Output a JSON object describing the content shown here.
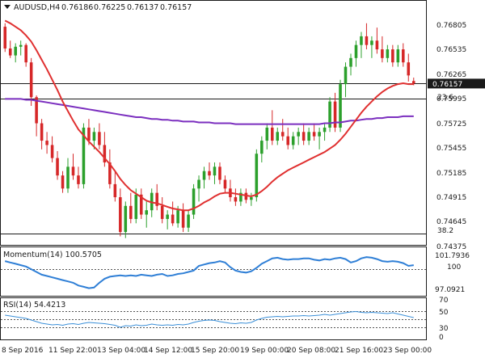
{
  "header": {
    "symbol": "AUDUSD,H4",
    "open": "0.76186",
    "high": "0.76225",
    "low": "0.76137",
    "close": "0.76157"
  },
  "colors": {
    "bull": "#2ca02c",
    "bear": "#d62728",
    "fast_ma": "#e03030",
    "slow_ma": "#7b2fbf",
    "momentum": "#2f7fd6",
    "rsi": "#3a8fd8",
    "level_line": "#1a1a1a",
    "dotted": "#555555",
    "price_box": "#1a1a1a"
  },
  "price_axis": {
    "ticks": [
      "0.76805",
      "0.76535",
      "0.76265",
      "0.75995",
      "0.75725",
      "0.75455",
      "0.75185",
      "0.74915",
      "0.74645",
      "0.74375"
    ],
    "current_price": "0.76157"
  },
  "fib_labels": {
    "upper": "23.6",
    "lower": "38.2"
  },
  "time_axis": {
    "ticks": [
      "8 Sep 2016",
      "11 Sep 22:00",
      "13 Sep 04:00",
      "14 Sep 12:00",
      "15 Sep 20:00",
      "19 Sep 00:00",
      "20 Sep 08:00",
      "21 Sep 16:00",
      "23 Sep 00:00"
    ]
  },
  "momentum_panel": {
    "title": "Momentum(14) 100.5705",
    "ticks": [
      "101.7936",
      "100",
      "97.0921"
    ]
  },
  "rsi_panel": {
    "title": "RSI(14) 54.4213",
    "ticks": [
      "70",
      "50",
      "30",
      "0"
    ]
  },
  "chart_data": {
    "type": "candlestick",
    "title": "AUDUSD,H4",
    "ylim": [
      0.7433,
      0.7695
    ],
    "levels": [
      {
        "label": "23.6",
        "value": 0.7598
      },
      {
        "label": "38.2",
        "value": 0.7443
      },
      {
        "label": "current",
        "value": 0.76157
      }
    ],
    "candles": [
      [
        0.7681,
        0.7685,
        0.7652,
        0.7656
      ],
      [
        0.7656,
        0.7665,
        0.7645,
        0.7648
      ],
      [
        0.7648,
        0.7662,
        0.764,
        0.7658
      ],
      [
        0.7658,
        0.7665,
        0.7648,
        0.766
      ],
      [
        0.766,
        0.7662,
        0.7635,
        0.764
      ],
      [
        0.764,
        0.7645,
        0.759,
        0.76
      ],
      [
        0.76,
        0.7602,
        0.7555,
        0.757
      ],
      [
        0.757,
        0.7575,
        0.754,
        0.755
      ],
      [
        0.755,
        0.756,
        0.7535,
        0.7545
      ],
      [
        0.7545,
        0.7555,
        0.7525,
        0.753
      ],
      [
        0.753,
        0.7538,
        0.7505,
        0.751
      ],
      [
        0.751,
        0.7515,
        0.749,
        0.7495
      ],
      [
        0.7495,
        0.753,
        0.749,
        0.752
      ],
      [
        0.752,
        0.7535,
        0.7505,
        0.751
      ],
      [
        0.751,
        0.752,
        0.7495,
        0.75
      ],
      [
        0.75,
        0.757,
        0.7495,
        0.7565
      ],
      [
        0.7565,
        0.7575,
        0.7545,
        0.755
      ],
      [
        0.755,
        0.7565,
        0.754,
        0.756
      ],
      [
        0.756,
        0.757,
        0.754,
        0.7545
      ],
      [
        0.7545,
        0.756,
        0.752,
        0.7525
      ],
      [
        0.7525,
        0.754,
        0.7495,
        0.75
      ],
      [
        0.75,
        0.7515,
        0.748,
        0.7485
      ],
      [
        0.7485,
        0.7495,
        0.744,
        0.7445
      ],
      [
        0.7445,
        0.748,
        0.7438,
        0.7475
      ],
      [
        0.7475,
        0.749,
        0.7455,
        0.746
      ],
      [
        0.746,
        0.7495,
        0.7455,
        0.7488
      ],
      [
        0.7488,
        0.7495,
        0.746,
        0.7465
      ],
      [
        0.7465,
        0.748,
        0.745,
        0.747
      ],
      [
        0.747,
        0.7495,
        0.7462,
        0.749
      ],
      [
        0.749,
        0.75,
        0.747,
        0.7475
      ],
      [
        0.7475,
        0.7485,
        0.7455,
        0.746
      ],
      [
        0.746,
        0.747,
        0.7448,
        0.7465
      ],
      [
        0.7465,
        0.748,
        0.7452,
        0.7455
      ],
      [
        0.7455,
        0.7475,
        0.745,
        0.747
      ],
      [
        0.747,
        0.7478,
        0.7445,
        0.745
      ],
      [
        0.745,
        0.747,
        0.7445,
        0.7465
      ],
      [
        0.7465,
        0.75,
        0.746,
        0.7495
      ],
      [
        0.7495,
        0.751,
        0.748,
        0.7505
      ],
      [
        0.7505,
        0.752,
        0.7495,
        0.7515
      ],
      [
        0.7515,
        0.7525,
        0.7505,
        0.751
      ],
      [
        0.751,
        0.7525,
        0.75,
        0.752
      ],
      [
        0.752,
        0.7525,
        0.75,
        0.7505
      ],
      [
        0.7505,
        0.751,
        0.749,
        0.7495
      ],
      [
        0.7495,
        0.7505,
        0.748,
        0.7485
      ],
      [
        0.7485,
        0.7495,
        0.7475,
        0.748
      ],
      [
        0.748,
        0.7495,
        0.7475,
        0.749
      ],
      [
        0.749,
        0.7495,
        0.7478,
        0.7482
      ],
      [
        0.7482,
        0.749,
        0.7475,
        0.7485
      ],
      [
        0.7485,
        0.754,
        0.748,
        0.7535
      ],
      [
        0.7535,
        0.7555,
        0.7525,
        0.755
      ],
      [
        0.755,
        0.757,
        0.754,
        0.7565
      ],
      [
        0.7565,
        0.7585,
        0.7545,
        0.755
      ],
      [
        0.755,
        0.7565,
        0.7545,
        0.756
      ],
      [
        0.756,
        0.7575,
        0.755,
        0.7555
      ],
      [
        0.7555,
        0.7565,
        0.754,
        0.7545
      ],
      [
        0.7545,
        0.756,
        0.754,
        0.7555
      ],
      [
        0.7555,
        0.7565,
        0.7545,
        0.756
      ],
      [
        0.756,
        0.757,
        0.7545,
        0.755
      ],
      [
        0.755,
        0.7565,
        0.7545,
        0.756
      ],
      [
        0.756,
        0.757,
        0.755,
        0.7555
      ],
      [
        0.7555,
        0.7565,
        0.754,
        0.756
      ],
      [
        0.756,
        0.757,
        0.755,
        0.7565
      ],
      [
        0.7565,
        0.76,
        0.756,
        0.7595
      ],
      [
        0.7595,
        0.7605,
        0.756,
        0.7565
      ],
      [
        0.7565,
        0.762,
        0.756,
        0.7615
      ],
      [
        0.7615,
        0.764,
        0.76,
        0.7635
      ],
      [
        0.7635,
        0.765,
        0.7625,
        0.7645
      ],
      [
        0.7645,
        0.7665,
        0.7635,
        0.766
      ],
      [
        0.766,
        0.7675,
        0.7645,
        0.767
      ],
      [
        0.767,
        0.7685,
        0.7655,
        0.766
      ],
      [
        0.766,
        0.767,
        0.7645,
        0.7665
      ],
      [
        0.7665,
        0.768,
        0.765,
        0.7655
      ],
      [
        0.7655,
        0.767,
        0.764,
        0.7645
      ],
      [
        0.7645,
        0.766,
        0.764,
        0.7655
      ],
      [
        0.7655,
        0.766,
        0.7635,
        0.764
      ],
      [
        0.764,
        0.766,
        0.7635,
        0.7655
      ],
      [
        0.7655,
        0.7662,
        0.7635,
        0.764
      ],
      [
        0.764,
        0.765,
        0.7618,
        0.7625
      ],
      [
        0.76186,
        0.76225,
        0.76137,
        0.76157
      ]
    ],
    "fast_ma": [
      0.7688,
      0.7685,
      0.7681,
      0.7677,
      0.7671,
      0.7664,
      0.7654,
      0.7643,
      0.7632,
      0.762,
      0.7608,
      0.7595,
      0.7584,
      0.7573,
      0.7563,
      0.7556,
      0.7549,
      0.7543,
      0.7537,
      0.753,
      0.7523,
      0.7515,
      0.7506,
      0.7499,
      0.7493,
      0.7489,
      0.7485,
      0.7481,
      0.7479,
      0.7478,
      0.7476,
      0.7474,
      0.7472,
      0.7471,
      0.747,
      0.747,
      0.7472,
      0.7475,
      0.7479,
      0.7482,
      0.7486,
      0.7489,
      0.749,
      0.749,
      0.7489,
      0.7488,
      0.7487,
      0.7486,
      0.7488,
      0.7492,
      0.7497,
      0.7503,
      0.7508,
      0.7512,
      0.7516,
      0.7519,
      0.7522,
      0.7525,
      0.7528,
      0.7531,
      0.7534,
      0.7537,
      0.7541,
      0.7545,
      0.7551,
      0.7558,
      0.7566,
      0.7574,
      0.7582,
      0.7589,
      0.7595,
      0.7601,
      0.7606,
      0.761,
      0.7613,
      0.7615,
      0.7616,
      0.7615,
      0.7615
    ],
    "slow_ma": [
      0.7598,
      0.7598,
      0.7598,
      0.7598,
      0.7597,
      0.7597,
      0.7596,
      0.7595,
      0.7594,
      0.7593,
      0.7592,
      0.7591,
      0.759,
      0.7589,
      0.7588,
      0.7587,
      0.7586,
      0.7585,
      0.7584,
      0.7583,
      0.7582,
      0.7581,
      0.758,
      0.7579,
      0.7578,
      0.7577,
      0.7577,
      0.7576,
      0.7575,
      0.7575,
      0.7574,
      0.7574,
      0.7573,
      0.7573,
      0.7572,
      0.7572,
      0.7572,
      0.7571,
      0.7571,
      0.7571,
      0.757,
      0.757,
      0.757,
      0.757,
      0.7569,
      0.7569,
      0.7569,
      0.7569,
      0.7569,
      0.7569,
      0.7569,
      0.7569,
      0.7569,
      0.7569,
      0.7569,
      0.7569,
      0.7569,
      0.7569,
      0.7569,
      0.7569,
      0.7569,
      0.757,
      0.757,
      0.7571,
      0.7571,
      0.7572,
      0.7573,
      0.7573,
      0.7574,
      0.7575,
      0.7575,
      0.7576,
      0.7576,
      0.7577,
      0.7577,
      0.7577,
      0.7578,
      0.7578,
      0.7578
    ],
    "momentum": {
      "ylim": [
        96.2,
        103.0
      ],
      "values": [
        101.2,
        101.0,
        100.8,
        100.6,
        100.4,
        100.0,
        99.6,
        99.2,
        99.0,
        98.8,
        98.6,
        98.4,
        98.2,
        98.0,
        97.6,
        97.4,
        97.2,
        97.3,
        98.0,
        98.6,
        98.9,
        99.0,
        99.1,
        99.0,
        99.1,
        99.0,
        99.2,
        99.1,
        99.0,
        99.2,
        99.3,
        99.0,
        99.1,
        99.3,
        99.4,
        99.6,
        99.8,
        100.5,
        100.7,
        100.9,
        101.0,
        101.2,
        101.0,
        100.3,
        99.8,
        99.6,
        99.5,
        99.7,
        100.2,
        100.8,
        101.2,
        101.6,
        101.7,
        101.5,
        101.4,
        101.5,
        101.5,
        101.6,
        101.6,
        101.4,
        101.3,
        101.5,
        101.4,
        101.6,
        101.7,
        101.5,
        101.0,
        101.2,
        101.6,
        101.8,
        101.7,
        101.5,
        101.2,
        101.1,
        101.2,
        101.1,
        100.9,
        100.5,
        100.6
      ]
    },
    "rsi": {
      "ylim": [
        0,
        100
      ],
      "levels": [
        70,
        50,
        30
      ],
      "values": [
        60,
        58,
        56,
        54,
        52,
        48,
        44,
        40,
        38,
        36,
        37,
        35,
        38,
        39,
        37,
        40,
        42,
        41,
        40,
        39,
        37,
        35,
        30,
        34,
        33,
        36,
        34,
        35,
        38,
        36,
        35,
        36,
        35,
        37,
        36,
        38,
        42,
        45,
        47,
        48,
        47,
        44,
        42,
        40,
        39,
        41,
        40,
        42,
        48,
        52,
        55,
        56,
        57,
        56,
        57,
        58,
        58,
        59,
        58,
        59,
        60,
        62,
        60,
        62,
        64,
        66,
        68,
        69,
        67,
        66,
        67,
        66,
        65,
        64,
        66,
        63,
        60,
        57,
        54
      ]
    }
  }
}
